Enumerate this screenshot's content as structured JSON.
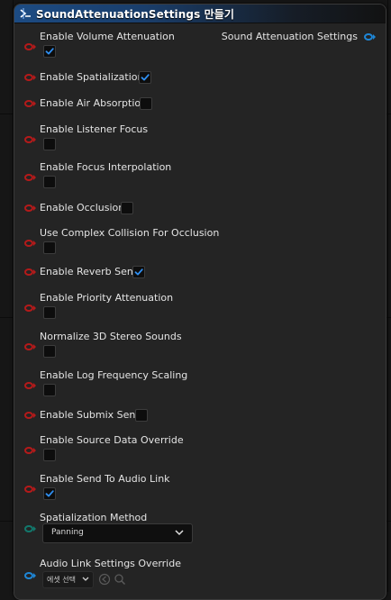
{
  "node": {
    "title": "SoundAttenuationSettings 만들기",
    "output_pin_label": "Sound Attenuation Settings",
    "pins": [
      {
        "label": "Enable Volume Attenuation",
        "checked": true,
        "layout": "below"
      },
      {
        "label": "Enable Spatialization",
        "checked": true,
        "layout": "inline"
      },
      {
        "label": "Enable Air Absorption",
        "checked": false,
        "layout": "inline"
      },
      {
        "label": "Enable Listener Focus",
        "checked": false,
        "layout": "below"
      },
      {
        "label": "Enable Focus Interpolation",
        "checked": false,
        "layout": "below"
      },
      {
        "label": "Enable Occlusion",
        "checked": false,
        "layout": "inline"
      },
      {
        "label": "Use Complex Collision For Occlusion",
        "checked": false,
        "layout": "below"
      },
      {
        "label": "Enable Reverb Send",
        "checked": true,
        "layout": "inline"
      },
      {
        "label": "Enable Priority Attenuation",
        "checked": false,
        "layout": "below"
      },
      {
        "label": "Normalize 3D Stereo Sounds",
        "checked": false,
        "layout": "below"
      },
      {
        "label": "Enable Log Frequency Scaling",
        "checked": false,
        "layout": "below"
      },
      {
        "label": "Enable Submix Send",
        "checked": false,
        "layout": "inline"
      },
      {
        "label": "Enable Source Data Override",
        "checked": false,
        "layout": "below"
      },
      {
        "label": "Enable Send To Audio Link",
        "checked": true,
        "layout": "below"
      }
    ],
    "spatialization": {
      "label": "Spatialization Method",
      "value": "Panning"
    },
    "audio_link": {
      "label": "Audio Link Settings Override",
      "asset_value": "에셋 선택"
    }
  },
  "colors": {
    "header_blue": "#1c4b83",
    "bool_pin": "#b41a1a",
    "enum_pin": "#12786c",
    "struct_pin": "#1e86d6",
    "check": "#2f8ff2"
  }
}
